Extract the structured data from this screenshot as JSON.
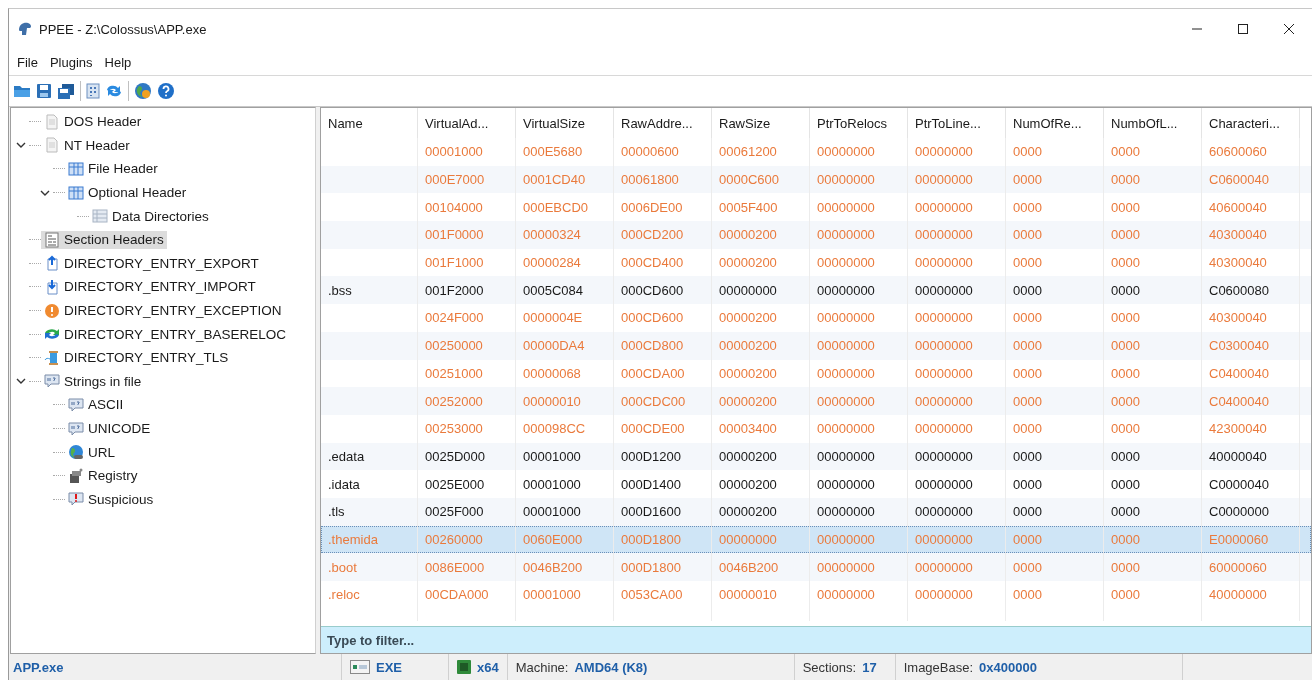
{
  "window": {
    "title": "PPEE - Z:\\Colossus\\APP.exe"
  },
  "menu": [
    {
      "label": "File"
    },
    {
      "label": "Plugins"
    },
    {
      "label": "Help"
    }
  ],
  "tree": [
    {
      "label": "DOS Header",
      "kind": "doc",
      "selected": false
    },
    {
      "label": "NT Header",
      "kind": "doc",
      "selected": false,
      "expanded": true,
      "children": [
        {
          "label": "File Header",
          "kind": "grid",
          "selected": false
        },
        {
          "label": "Optional Header",
          "kind": "grid",
          "selected": false,
          "expanded": true,
          "children": [
            {
              "label": "Data Directories",
              "kind": "table",
              "selected": false
            }
          ]
        }
      ]
    },
    {
      "label": "Section Headers",
      "kind": "section",
      "selected": true
    },
    {
      "label": "DIRECTORY_ENTRY_EXPORT",
      "kind": "export",
      "selected": false
    },
    {
      "label": "DIRECTORY_ENTRY_IMPORT",
      "kind": "import",
      "selected": false
    },
    {
      "label": "DIRECTORY_ENTRY_EXCEPTION",
      "kind": "exception",
      "selected": false
    },
    {
      "label": "DIRECTORY_ENTRY_BASERELOC",
      "kind": "reloc",
      "selected": false
    },
    {
      "label": "DIRECTORY_ENTRY_TLS",
      "kind": "tls",
      "selected": false
    },
    {
      "label": "Strings in file",
      "kind": "strings",
      "selected": false,
      "expanded": true,
      "children": [
        {
          "label": "ASCII",
          "kind": "strings",
          "selected": false
        },
        {
          "label": "UNICODE",
          "kind": "strings",
          "selected": false
        },
        {
          "label": "URL",
          "kind": "globe",
          "selected": false
        },
        {
          "label": "Registry",
          "kind": "registry",
          "selected": false
        },
        {
          "label": "Suspicious",
          "kind": "suspicious",
          "selected": false
        }
      ]
    }
  ],
  "table": {
    "columns": [
      "Name",
      "VirtualAd...",
      "VirtualSize",
      "RawAddre...",
      "RawSize",
      "PtrToRelocs",
      "PtrToLine...",
      "NumOfRe...",
      "NumbOfL...",
      "Characteri..."
    ],
    "rows": [
      {
        "values": [
          "00001000",
          "000E5680",
          "00000600",
          "00061200",
          "00000000",
          "00000000",
          "0000",
          "0000",
          "60600060"
        ],
        "flagged": true,
        "selected": false
      },
      {
        "values": [
          "000E7000",
          "0001CD40",
          "00061800",
          "0000C600",
          "00000000",
          "00000000",
          "0000",
          "0000",
          "C0600040"
        ],
        "flagged": true,
        "selected": false
      },
      {
        "values": [
          "00104000",
          "000EBCD0",
          "0006DE00",
          "0005F400",
          "00000000",
          "00000000",
          "0000",
          "0000",
          "40600040"
        ],
        "flagged": true,
        "selected": false
      },
      {
        "values": [
          "001F0000",
          "00000324",
          "000CD200",
          "00000200",
          "00000000",
          "00000000",
          "0000",
          "0000",
          "40300040"
        ],
        "flagged": true,
        "selected": false
      },
      {
        "values": [
          "001F1000",
          "00000284",
          "000CD400",
          "00000200",
          "00000000",
          "00000000",
          "0000",
          "0000",
          "40300040"
        ],
        "flagged": true,
        "selected": false
      },
      {
        "name": ".bss",
        "values": [
          "001F2000",
          "0005C084",
          "000CD600",
          "00000000",
          "00000000",
          "00000000",
          "0000",
          "0000",
          "C0600080"
        ],
        "flagged": false,
        "selected": false
      },
      {
        "values": [
          "0024F000",
          "0000004E",
          "000CD600",
          "00000200",
          "00000000",
          "00000000",
          "0000",
          "0000",
          "40300040"
        ],
        "flagged": true,
        "selected": false
      },
      {
        "values": [
          "00250000",
          "00000DA4",
          "000CD800",
          "00000200",
          "00000000",
          "00000000",
          "0000",
          "0000",
          "C0300040"
        ],
        "flagged": true,
        "selected": false
      },
      {
        "values": [
          "00251000",
          "00000068",
          "000CDA00",
          "00000200",
          "00000000",
          "00000000",
          "0000",
          "0000",
          "C0400040"
        ],
        "flagged": true,
        "selected": false
      },
      {
        "values": [
          "00252000",
          "00000010",
          "000CDC00",
          "00000200",
          "00000000",
          "00000000",
          "0000",
          "0000",
          "C0400040"
        ],
        "flagged": true,
        "selected": false
      },
      {
        "values": [
          "00253000",
          "000098CC",
          "000CDE00",
          "00003400",
          "00000000",
          "00000000",
          "0000",
          "0000",
          "42300040"
        ],
        "flagged": true,
        "selected": false
      },
      {
        "name": ".edata",
        "values": [
          "0025D000",
          "00001000",
          "000D1200",
          "00000200",
          "00000000",
          "00000000",
          "0000",
          "0000",
          "40000040"
        ],
        "flagged": false,
        "selected": false
      },
      {
        "name": ".idata",
        "values": [
          "0025E000",
          "00001000",
          "000D1400",
          "00000200",
          "00000000",
          "00000000",
          "0000",
          "0000",
          "C0000040"
        ],
        "flagged": false,
        "selected": false
      },
      {
        "name": ".tls",
        "values": [
          "0025F000",
          "00001000",
          "000D1600",
          "00000200",
          "00000000",
          "00000000",
          "0000",
          "0000",
          "C0000000"
        ],
        "flagged": false,
        "selected": false
      },
      {
        "name": ".themida",
        "values": [
          "00260000",
          "0060E000",
          "000D1800",
          "00000000",
          "00000000",
          "00000000",
          "0000",
          "0000",
          "E0000060"
        ],
        "flagged": true,
        "selected": true
      },
      {
        "name": ".boot",
        "values": [
          "0086E000",
          "0046B200",
          "000D1800",
          "0046B200",
          "00000000",
          "00000000",
          "0000",
          "0000",
          "60000060"
        ],
        "flagged": true,
        "selected": false
      },
      {
        "name": ".reloc",
        "values": [
          "00CDA000",
          "00001000",
          "0053CA00",
          "00000010",
          "00000000",
          "00000000",
          "0000",
          "0000",
          "40000000"
        ],
        "flagged": true,
        "selected": false
      }
    ]
  },
  "filter": {
    "placeholder": "Type to filter..."
  },
  "status_bar": {
    "file": "APP.exe",
    "type": "EXE",
    "arch": "x64",
    "machine": {
      "label": "Machine:",
      "value": "AMD64 (K8)"
    },
    "sections": {
      "label": "Sections:",
      "value": "17"
    },
    "image_base": {
      "label": "ImageBase:",
      "value": "0x400000"
    }
  }
}
